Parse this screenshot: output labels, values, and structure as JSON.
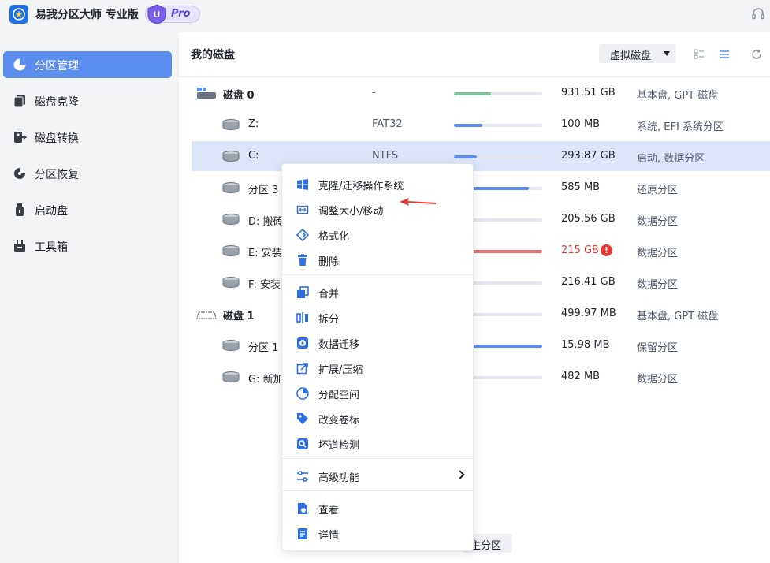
{
  "app": {
    "title": "易我分区大师 专业版",
    "badge_letter": "U",
    "badge_text": "Pro",
    "accent": "#5b8def"
  },
  "sidebar": {
    "items": [
      {
        "label": "分区管理",
        "icon": "partition-icon",
        "active": true
      },
      {
        "label": "磁盘克隆",
        "icon": "clone-icon",
        "active": false
      },
      {
        "label": "磁盘转换",
        "icon": "convert-icon",
        "active": false
      },
      {
        "label": "分区恢复",
        "icon": "recover-icon",
        "active": false
      },
      {
        "label": "启动盘",
        "icon": "usb-icon",
        "active": false
      },
      {
        "label": "工具箱",
        "icon": "toolbox-icon",
        "active": false
      }
    ]
  },
  "main": {
    "title": "我的磁盘",
    "virtual_disk_label": "虚拟磁盘",
    "bottom_button_label": "主分区",
    "rows": [
      {
        "kind": "disk",
        "name": "磁盘 0",
        "fs": "-",
        "used": 0.42,
        "bar_color": "#7cc4a0",
        "size": "931.51 GB",
        "type": "基本盘, GPT 磁盘"
      },
      {
        "kind": "part",
        "name": "Z:",
        "fs": "FAT32",
        "used": 0.32,
        "bar_color": "#5b8def",
        "size": "100 MB",
        "type": "系统, EFI 系统分区"
      },
      {
        "kind": "part",
        "name": "C:",
        "fs": "NTFS",
        "used": 0.26,
        "bar_color": "#5b8def",
        "size": "293.87 GB",
        "type": "启动, 数据分区",
        "selected": true
      },
      {
        "kind": "part",
        "name": "分区 3",
        "fs": "",
        "used": 0.85,
        "bar_color": "#5b8def",
        "size": "585 MB",
        "type": "还原分区"
      },
      {
        "kind": "part",
        "name": "D: 搬砖",
        "fs": "",
        "used": 0.0,
        "bar_color": "#5b8def",
        "size": "205.56 GB",
        "type": "数据分区"
      },
      {
        "kind": "part",
        "name": "E: 安装",
        "fs": "",
        "used": 1.0,
        "bar_color": "#f07070",
        "size": "215 GB",
        "type": "数据分区",
        "warn": true
      },
      {
        "kind": "part",
        "name": "F: 安装",
        "fs": "",
        "used": 0.15,
        "bar_color": "#5b8def",
        "size": "216.41 GB",
        "type": "数据分区"
      },
      {
        "kind": "disk",
        "name": "磁盘 1",
        "fs": "",
        "used": 0.0,
        "bar_color": "#5b8def",
        "size": "499.97 MB",
        "type": "基本盘, GPT 磁盘"
      },
      {
        "kind": "part",
        "name": "分区 1",
        "fs": "",
        "used": 1.0,
        "bar_color": "#5b8def",
        "size": "15.98 MB",
        "type": "保留分区"
      },
      {
        "kind": "part",
        "name": "G: 新加",
        "fs": "",
        "used": 0.0,
        "bar_color": "#5b8def",
        "size": "482 MB",
        "type": "数据分区"
      }
    ]
  },
  "context_menu": {
    "items": [
      {
        "label": "克隆/迁移操作系统",
        "icon": "windows-icon"
      },
      {
        "label": "调整大小/移动",
        "icon": "resize-icon"
      },
      {
        "label": "格式化",
        "icon": "format-icon"
      },
      {
        "label": "删除",
        "icon": "trash-icon"
      },
      {
        "label": "合并",
        "icon": "merge-icon"
      },
      {
        "label": "拆分",
        "icon": "split-icon"
      },
      {
        "label": "数据迁移",
        "icon": "migrate-icon"
      },
      {
        "label": "扩展/压缩",
        "icon": "extend-icon"
      },
      {
        "label": "分配空间",
        "icon": "allocate-icon"
      },
      {
        "label": "改变卷标",
        "icon": "label-icon"
      },
      {
        "label": "坏道检测",
        "icon": "scan-icon"
      },
      {
        "label": "高级功能",
        "icon": "sliders-icon",
        "submenu": true
      },
      {
        "label": "查看",
        "icon": "view-icon"
      },
      {
        "label": "详情",
        "icon": "details-icon"
      }
    ]
  }
}
